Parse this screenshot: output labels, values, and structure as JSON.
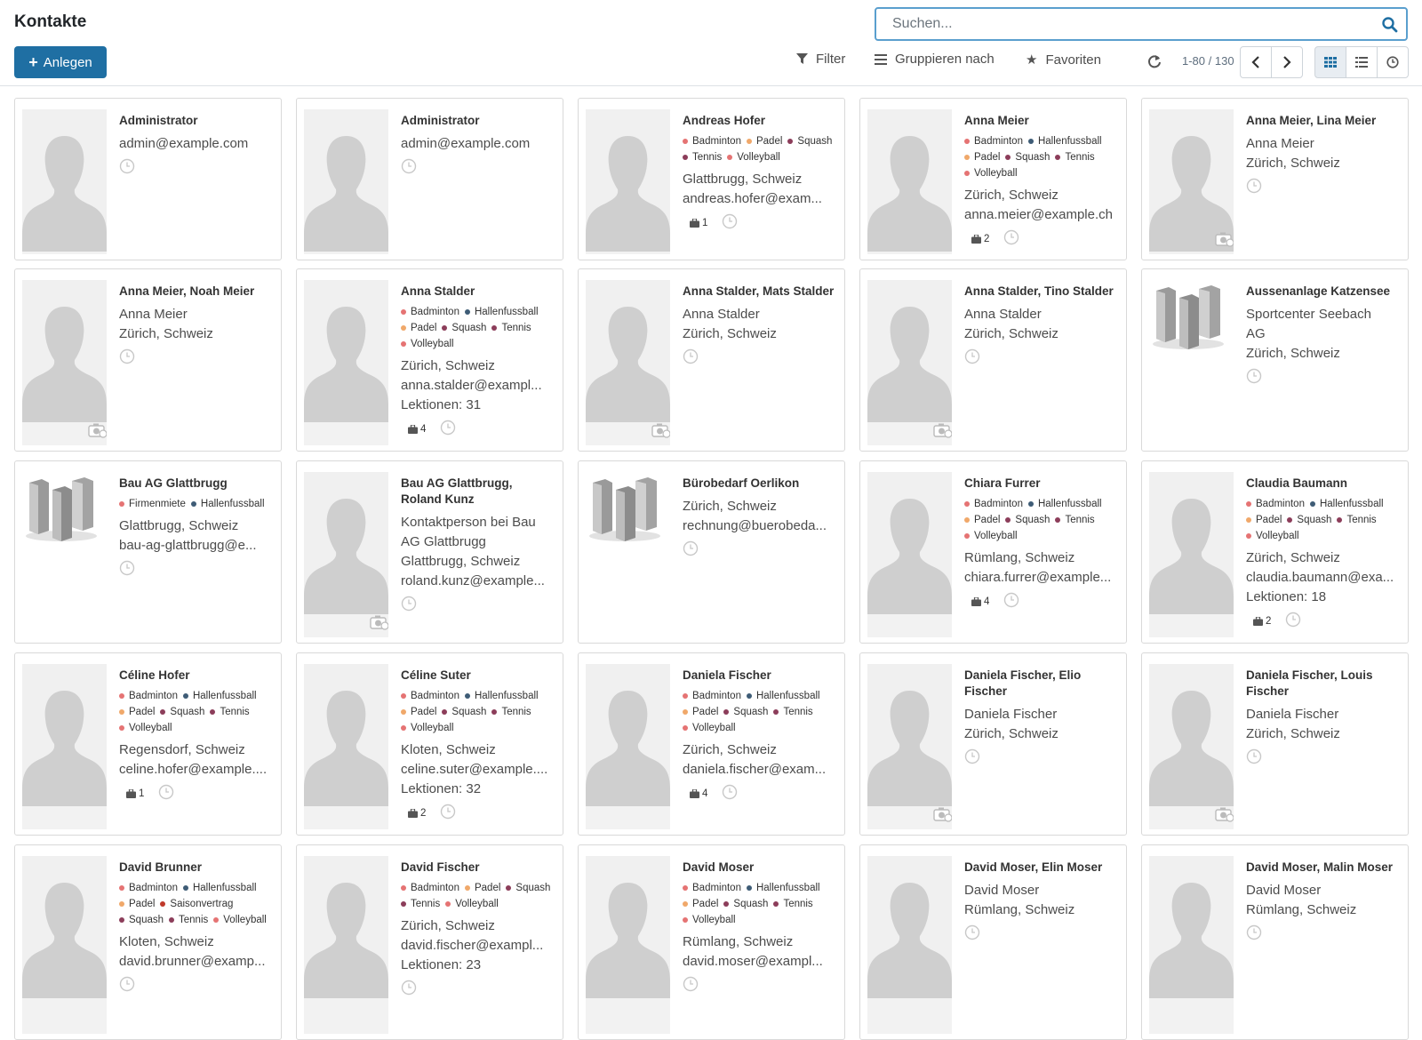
{
  "header": {
    "title": "Kontakte",
    "search_placeholder": "Suchen...",
    "create_label": "Anlegen",
    "filter_label": "Filter",
    "group_label": "Gruppieren nach",
    "favorites_label": "Favoriten",
    "pager_value": "1-80",
    "pager_separator": "/",
    "pager_total": "130"
  },
  "colors": {
    "accent": "#1f6fa3",
    "search_border": "#5a9fce",
    "tag_badminton": "#e57373",
    "tag_hallenfussball": "#3e5c76",
    "tag_padel": "#f0a86a",
    "tag_squash": "#8c3d5a",
    "tag_tennis": "#8c3d5a",
    "tag_volleyball": "#e57373",
    "tag_firmenmiete": "#e57373",
    "tag_saisonvertrag": "#c0392b"
  },
  "cards": [
    {
      "name": "Administrator",
      "image": "person",
      "lines": [
        "admin@example.com"
      ],
      "tags": [],
      "badge": "",
      "camera": false
    },
    {
      "name": "Administrator",
      "image": "person",
      "lines": [
        "admin@example.com"
      ],
      "tags": [],
      "badge": "",
      "camera": false
    },
    {
      "name": "Andreas Hofer",
      "image": "person",
      "lines": [
        "Glattbrugg, Schweiz",
        "andreas.hofer@exam..."
      ],
      "tags": [
        [
          "Badminton",
          "#e57373"
        ],
        [
          "Padel",
          "#f0a86a"
        ],
        [
          "Squash",
          "#8c3d5a"
        ],
        [
          "Tennis",
          "#8c3d5a"
        ],
        [
          "Volleyball",
          "#e57373"
        ]
      ],
      "badge": "1",
      "camera": false
    },
    {
      "name": "Anna Meier",
      "image": "person",
      "lines": [
        "Zürich, Schweiz",
        "anna.meier@example.ch"
      ],
      "tags": [
        [
          "Badminton",
          "#e57373"
        ],
        [
          "Hallenfussball",
          "#3e5c76"
        ],
        [
          "Padel",
          "#f0a86a"
        ],
        [
          "Squash",
          "#8c3d5a"
        ],
        [
          "Tennis",
          "#8c3d5a"
        ],
        [
          "Volleyball",
          "#e57373"
        ]
      ],
      "badge": "2",
      "camera": false
    },
    {
      "name": "Anna Meier, Lina Meier",
      "image": "person",
      "lines": [
        "Anna Meier",
        "Zürich, Schweiz"
      ],
      "tags": [],
      "badge": "",
      "camera": true
    },
    {
      "name": "Anna Meier, Noah Meier",
      "image": "person",
      "lines": [
        "Anna Meier",
        "Zürich, Schweiz"
      ],
      "tags": [],
      "badge": "",
      "camera": true
    },
    {
      "name": "Anna Stalder",
      "image": "person",
      "lines": [
        "Zürich, Schweiz",
        "anna.stalder@exampl...",
        "Lektionen: 31"
      ],
      "tags": [
        [
          "Badminton",
          "#e57373"
        ],
        [
          "Hallenfussball",
          "#3e5c76"
        ],
        [
          "Padel",
          "#f0a86a"
        ],
        [
          "Squash",
          "#8c3d5a"
        ],
        [
          "Tennis",
          "#8c3d5a"
        ],
        [
          "Volleyball",
          "#e57373"
        ]
      ],
      "badge": "4",
      "camera": false
    },
    {
      "name": "Anna Stalder, Mats Stalder",
      "image": "person",
      "lines": [
        "Anna Stalder",
        "Zürich, Schweiz"
      ],
      "tags": [],
      "badge": "",
      "camera": true
    },
    {
      "name": "Anna Stalder, Tino Stalder",
      "image": "person",
      "lines": [
        "Anna Stalder",
        "Zürich, Schweiz"
      ],
      "tags": [],
      "badge": "",
      "camera": true
    },
    {
      "name": "Aussenanlage Katzensee",
      "image": "company",
      "lines": [
        "Sportcenter Seebach",
        "AG",
        "Zürich, Schweiz"
      ],
      "tags": [],
      "badge": "",
      "camera": false
    },
    {
      "name": "Bau AG Glattbrugg",
      "image": "company",
      "lines": [
        "Glattbrugg, Schweiz",
        "bau-ag-glattbrugg@e..."
      ],
      "tags": [
        [
          "Firmenmiete",
          "#e57373"
        ],
        [
          "Hallenfussball",
          "#3e5c76"
        ]
      ],
      "badge": "",
      "camera": false
    },
    {
      "name": "Bau AG Glattbrugg, Roland Kunz",
      "image": "person",
      "lines": [
        "Kontaktperson bei Bau",
        "AG Glattbrugg",
        "Glattbrugg, Schweiz",
        "roland.kunz@example..."
      ],
      "tags": [],
      "badge": "",
      "camera": true
    },
    {
      "name": "Bürobedarf Oerlikon",
      "image": "company",
      "lines": [
        "Zürich, Schweiz",
        "rechnung@buerobeda..."
      ],
      "tags": [],
      "badge": "",
      "camera": false
    },
    {
      "name": "Chiara Furrer",
      "image": "person",
      "lines": [
        "Rümlang, Schweiz",
        "chiara.furrer@example..."
      ],
      "tags": [
        [
          "Badminton",
          "#e57373"
        ],
        [
          "Hallenfussball",
          "#3e5c76"
        ],
        [
          "Padel",
          "#f0a86a"
        ],
        [
          "Squash",
          "#8c3d5a"
        ],
        [
          "Tennis",
          "#8c3d5a"
        ],
        [
          "Volleyball",
          "#e57373"
        ]
      ],
      "badge": "4",
      "camera": false
    },
    {
      "name": "Claudia Baumann",
      "image": "person",
      "lines": [
        "Zürich, Schweiz",
        "claudia.baumann@exa...",
        "Lektionen: 18"
      ],
      "tags": [
        [
          "Badminton",
          "#e57373"
        ],
        [
          "Hallenfussball",
          "#3e5c76"
        ],
        [
          "Padel",
          "#f0a86a"
        ],
        [
          "Squash",
          "#8c3d5a"
        ],
        [
          "Tennis",
          "#8c3d5a"
        ],
        [
          "Volleyball",
          "#e57373"
        ]
      ],
      "badge": "2",
      "camera": false
    },
    {
      "name": "Céline Hofer",
      "image": "person",
      "lines": [
        "Regensdorf, Schweiz",
        "celine.hofer@example...."
      ],
      "tags": [
        [
          "Badminton",
          "#e57373"
        ],
        [
          "Hallenfussball",
          "#3e5c76"
        ],
        [
          "Padel",
          "#f0a86a"
        ],
        [
          "Squash",
          "#8c3d5a"
        ],
        [
          "Tennis",
          "#8c3d5a"
        ],
        [
          "Volleyball",
          "#e57373"
        ]
      ],
      "badge": "1",
      "camera": false
    },
    {
      "name": "Céline Suter",
      "image": "person",
      "lines": [
        "Kloten, Schweiz",
        "celine.suter@example....",
        "Lektionen: 32"
      ],
      "tags": [
        [
          "Badminton",
          "#e57373"
        ],
        [
          "Hallenfussball",
          "#3e5c76"
        ],
        [
          "Padel",
          "#f0a86a"
        ],
        [
          "Squash",
          "#8c3d5a"
        ],
        [
          "Tennis",
          "#8c3d5a"
        ],
        [
          "Volleyball",
          "#e57373"
        ]
      ],
      "badge": "2",
      "camera": false
    },
    {
      "name": "Daniela Fischer",
      "image": "person",
      "lines": [
        "Zürich, Schweiz",
        "daniela.fischer@exam..."
      ],
      "tags": [
        [
          "Badminton",
          "#e57373"
        ],
        [
          "Hallenfussball",
          "#3e5c76"
        ],
        [
          "Padel",
          "#f0a86a"
        ],
        [
          "Squash",
          "#8c3d5a"
        ],
        [
          "Tennis",
          "#8c3d5a"
        ],
        [
          "Volleyball",
          "#e57373"
        ]
      ],
      "badge": "4",
      "camera": false
    },
    {
      "name": "Daniela Fischer, Elio Fischer",
      "image": "person",
      "lines": [
        "Daniela Fischer",
        "Zürich, Schweiz"
      ],
      "tags": [],
      "badge": "",
      "camera": true
    },
    {
      "name": "Daniela Fischer, Louis Fischer",
      "image": "person",
      "lines": [
        "Daniela Fischer",
        "Zürich, Schweiz"
      ],
      "tags": [],
      "badge": "",
      "camera": true
    },
    {
      "name": "David Brunner",
      "image": "person",
      "lines": [
        "Kloten, Schweiz",
        "david.brunner@examp..."
      ],
      "tags": [
        [
          "Badminton",
          "#e57373"
        ],
        [
          "Hallenfussball",
          "#3e5c76"
        ],
        [
          "Padel",
          "#f0a86a"
        ],
        [
          "Saisonvertrag",
          "#c0392b"
        ],
        [
          "Squash",
          "#8c3d5a"
        ],
        [
          "Tennis",
          "#8c3d5a"
        ],
        [
          "Volleyball",
          "#e57373"
        ]
      ],
      "badge": "",
      "camera": false
    },
    {
      "name": "David Fischer",
      "image": "person",
      "lines": [
        "Zürich, Schweiz",
        "david.fischer@exampl...",
        "Lektionen: 23"
      ],
      "tags": [
        [
          "Badminton",
          "#e57373"
        ],
        [
          "Padel",
          "#f0a86a"
        ],
        [
          "Squash",
          "#8c3d5a"
        ],
        [
          "Tennis",
          "#8c3d5a"
        ],
        [
          "Volleyball",
          "#e57373"
        ]
      ],
      "badge": "",
      "camera": false
    },
    {
      "name": "David Moser",
      "image": "person",
      "lines": [
        "Rümlang, Schweiz",
        "david.moser@exampl..."
      ],
      "tags": [
        [
          "Badminton",
          "#e57373"
        ],
        [
          "Hallenfussball",
          "#3e5c76"
        ],
        [
          "Padel",
          "#f0a86a"
        ],
        [
          "Squash",
          "#8c3d5a"
        ],
        [
          "Tennis",
          "#8c3d5a"
        ],
        [
          "Volleyball",
          "#e57373"
        ]
      ],
      "badge": "",
      "camera": false
    },
    {
      "name": "David Moser, Elin Moser",
      "image": "person",
      "lines": [
        "David Moser",
        "Rümlang, Schweiz"
      ],
      "tags": [],
      "badge": "",
      "camera": false
    },
    {
      "name": "David Moser, Malin Moser",
      "image": "person",
      "lines": [
        "David Moser",
        "Rümlang, Schweiz"
      ],
      "tags": [],
      "badge": "",
      "camera": false
    }
  ]
}
